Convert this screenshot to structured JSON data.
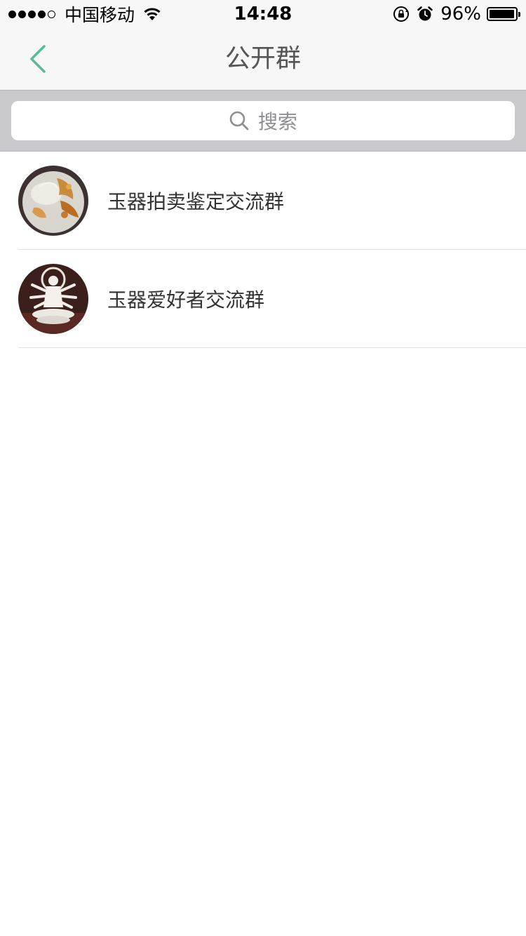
{
  "status_bar": {
    "carrier": "中国移动",
    "time": "14:48",
    "battery_percent": "96%",
    "battery_level": 0.96,
    "signal_bars_filled": 4,
    "signal_bars_total": 5,
    "icons": [
      "wifi-icon",
      "rotation-lock-icon",
      "alarm-icon",
      "battery-icon"
    ]
  },
  "nav": {
    "back_icon": "chevron-left-icon",
    "title": "公开群",
    "accent_color": "#5bb89a"
  },
  "search": {
    "icon": "search-icon",
    "placeholder": "搜索"
  },
  "groups": [
    {
      "name": "玉器拍卖鉴定交流群",
      "avatar": "jade-carving-avatar"
    },
    {
      "name": "玉器爱好者交流群",
      "avatar": "jade-guanyin-avatar"
    }
  ]
}
